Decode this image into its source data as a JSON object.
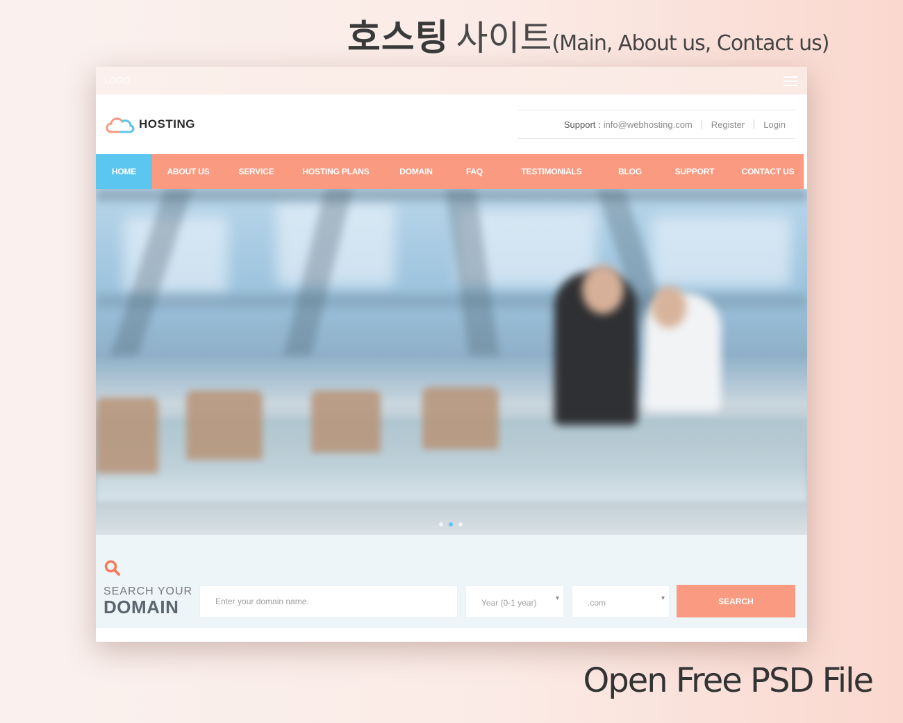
{
  "headline": {
    "bold": "호스팅",
    "light": "사이트",
    "sub": "(Main, About us, Contact us)"
  },
  "caption": "Open Free PSD File",
  "site": {
    "top_brand": "LOGO",
    "logo_text": "HOSTING",
    "support_label": "Support :",
    "support_email": "info@webhosting.com",
    "register": "Register",
    "login": "Login",
    "nav": [
      "HOME",
      "ABOUT US",
      "SERVICE",
      "HOSTING PLANS",
      "DOMAIN",
      "FAQ",
      "TESTIMONIALS",
      "BLOG",
      "SUPPORT",
      "CONTACT US"
    ],
    "nav_active": "HOME",
    "slider_active_index": 2,
    "search": {
      "title_line1": "SEARCH YOUR",
      "title_line2": "DOMAIN",
      "domain_placeholder": "Enter your domain name.",
      "year_value": "Year (0-1 year)",
      "tld_value": ".com",
      "button": "SEARCH"
    }
  },
  "colors": {
    "accent": "#fa9a80",
    "active": "#5bc6ef",
    "text_dark": "#2c2c2c"
  }
}
